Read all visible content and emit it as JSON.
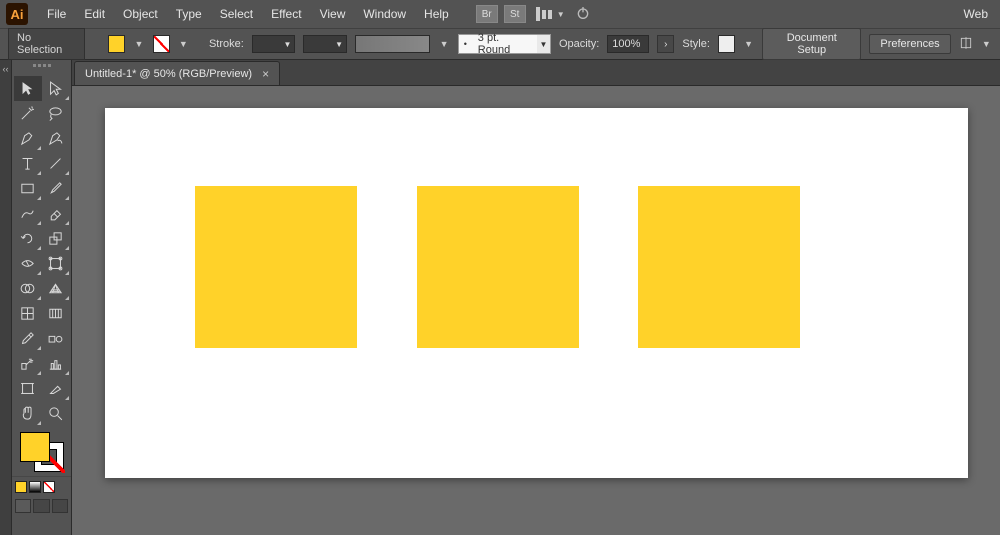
{
  "app": {
    "icon_label": "Ai"
  },
  "menu": {
    "file": "File",
    "edit": "Edit",
    "object": "Object",
    "type": "Type",
    "select": "Select",
    "effect": "Effect",
    "view": "View",
    "window": "Window",
    "help": "Help",
    "br": "Br",
    "st": "St",
    "workspace": "Web"
  },
  "control": {
    "no_selection": "No Selection",
    "stroke_label": "Stroke:",
    "brush_profile": "3 pt. Round",
    "opacity_label": "Opacity:",
    "opacity_value": "100%",
    "style_label": "Style:",
    "doc_setup": "Document Setup",
    "preferences": "Preferences"
  },
  "tab": {
    "title": "Untitled-1* @ 50% (RGB/Preview)",
    "close": "×"
  },
  "colors": {
    "fill": "#ffd229",
    "artboard": "#ffffff"
  },
  "canvas": {
    "shapes": [
      {
        "type": "rect",
        "fill": "#ffd229"
      },
      {
        "type": "rect",
        "fill": "#ffd229"
      },
      {
        "type": "rect",
        "fill": "#ffd229"
      }
    ]
  }
}
